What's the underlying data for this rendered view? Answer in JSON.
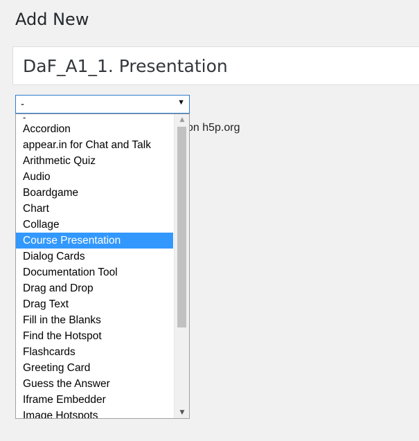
{
  "page": {
    "heading": "Add New",
    "title_value": "DaF_A1_1. Presentation"
  },
  "library_select": {
    "selected_label": "-",
    "behind_text": "on h5p.org",
    "highlighted": "Course Presentation",
    "options": [
      "-",
      "Accordion",
      "appear.in for Chat and Talk",
      "Arithmetic Quiz",
      "Audio",
      "Boardgame",
      "Chart",
      "Collage",
      "Course Presentation",
      "Dialog Cards",
      "Documentation Tool",
      "Drag and Drop",
      "Drag Text",
      "Fill in the Blanks",
      "Find the Hotspot",
      "Flashcards",
      "Greeting Card",
      "Guess the Answer",
      "Iframe Embedder",
      "Image Hotspots"
    ]
  },
  "icons": {
    "dropdown_arrow": "chevron-down-icon",
    "scroll_up": "scroll-up-arrow-icon",
    "scroll_down": "scroll-down-arrow-icon"
  },
  "colors": {
    "selection": "#3298fe",
    "focus_border": "#2b7bcf"
  }
}
